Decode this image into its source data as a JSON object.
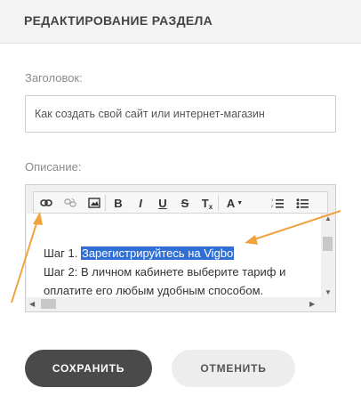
{
  "header": {
    "title": "РЕДАКТИРОВАНИЕ РАЗДЕЛА"
  },
  "form": {
    "title_label": "Заголовок:",
    "title_value": "Как создать свой сайт или интернет-магазин",
    "description_label": "Описание:"
  },
  "editor": {
    "toolbar": [
      {
        "name": "link-icon",
        "glyph": "🔗"
      },
      {
        "name": "unlink-icon",
        "glyph": "⛓"
      },
      {
        "name": "image-icon",
        "glyph": "▣"
      },
      {
        "name": "bold-icon",
        "glyph": "B"
      },
      {
        "name": "italic-icon",
        "glyph": "I"
      },
      {
        "name": "underline-icon",
        "glyph": "U"
      },
      {
        "name": "strikethrough-icon",
        "glyph": "S"
      },
      {
        "name": "clear-format-icon",
        "glyph": "T"
      },
      {
        "name": "font-color-icon",
        "glyph": "A"
      },
      {
        "name": "numbered-list-icon",
        "glyph": "≡"
      },
      {
        "name": "bulleted-list-icon",
        "glyph": "☰"
      }
    ],
    "lines": {
      "step1_prefix": "Шаг 1.",
      "step1_selected": "Зарегистрируйтесь на Vigbo",
      "step2": "Шаг 2: В личном кабинете выберите тариф и",
      "step2_cont": "оплатите его любым удобным способом."
    }
  },
  "buttons": {
    "save": "СОХРАНИТЬ",
    "cancel": "ОТМЕНИТЬ"
  },
  "colors": {
    "selection": "#2f6fd6",
    "annotation_arrow": "#f0a23c",
    "save_bg": "#4a4a4a"
  }
}
